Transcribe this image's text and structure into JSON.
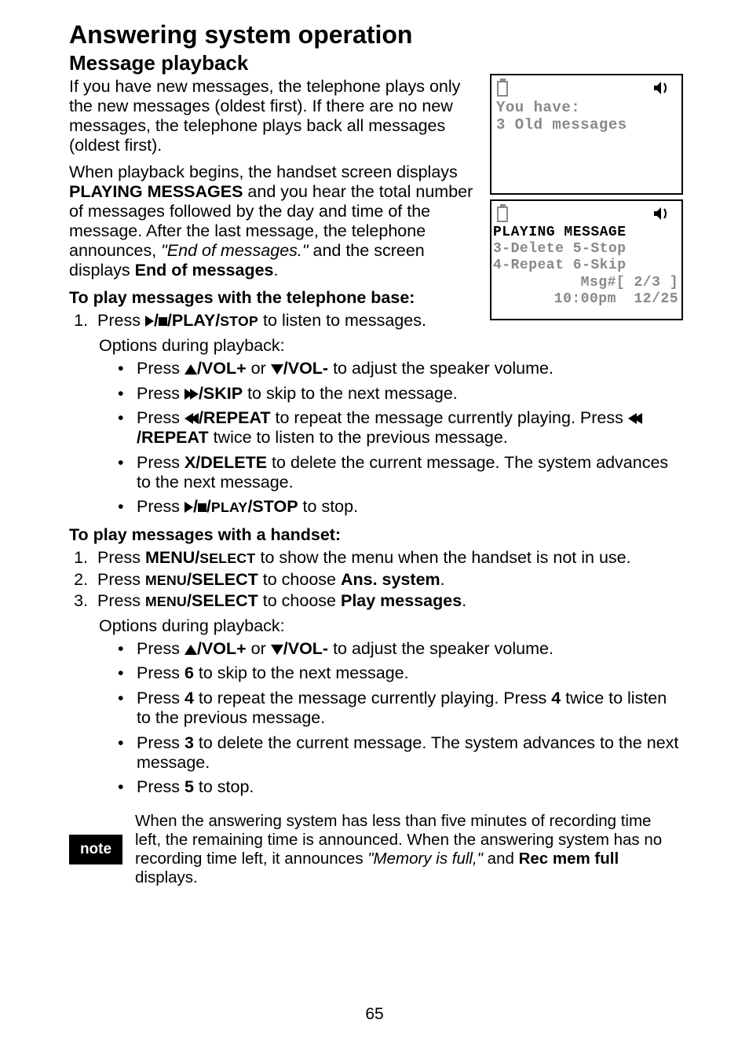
{
  "title": "Answering system operation",
  "section": "Message playback",
  "para1": "If you have new messages, the telephone plays only the new messages (oldest first). If there are no new messages, the telephone plays back all messages (oldest first).",
  "para2_a": "When playback begins, the handset screen displays ",
  "para2_b": "PLAYING MESSAGES",
  "para2_c": " and you hear the total number of messages followed by the day and time of the message. After the last message, the telephone announces, ",
  "para2_d": "\"End of messages.\"",
  "para2_e": " and the screen displays ",
  "para2_f": "End of messages",
  "para2_g": ".",
  "sub_base": "To play messages with the telephone base:",
  "base_step_a": "Press ",
  "base_step_b": "/PLAY/",
  "base_step_c": "STOP",
  "base_step_d": " to listen to messages.",
  "opts_label": "Options during playback:",
  "b_vol_a": "Press  ",
  "b_vol_b": "/VOL+",
  "b_vol_c": " or ",
  "b_vol_d": "/VOL-",
  "b_vol_e": " to adjust the speaker volume.",
  "b_skip_a": "Press ",
  "b_skip_b": "/SKIP",
  "b_skip_c": " to skip to the next message.",
  "b_rep_a": "Press ",
  "b_rep_b": "/REPEAT",
  "b_rep_c": " to repeat the message currently playing. Press ",
  "b_rep_d": "/REPEAT",
  "b_rep_e": " twice to listen to the previous message.",
  "b_del_a": "Press ",
  "b_del_b": "X/DELETE",
  "b_del_c": " to delete the current message. The system advances to the next message.",
  "b_stop_a": "Press ",
  "b_stop_b": "/",
  "b_stop_c": "PLAY",
  "b_stop_d": "/STOP",
  "b_stop_e": " to stop.",
  "sub_hs": "To play messages with a handset:",
  "hs1_a": "Press ",
  "hs1_b": "MENU/",
  "hs1_c": "SELECT",
  "hs1_d": " to show the menu when the handset is not in use.",
  "hs2_a": "Press ",
  "hs2_b": "MENU",
  "hs2_c": "/SELECT",
  "hs2_d": " to choose ",
  "hs2_e": "Ans. system",
  "hs2_f": ".",
  "hs3_a": "Press ",
  "hs3_b": "MENU",
  "hs3_c": "/SELECT",
  "hs3_d": " to choose ",
  "hs3_e": "Play messages",
  "hs3_f": ".",
  "h_vol_a": "Press ",
  "h_vol_b": "/VOL+",
  "h_vol_c": " or ",
  "h_vol_d": "/VOL-",
  "h_vol_e": " to adjust the speaker volume.",
  "h_skip_a": "Press ",
  "h_skip_b": "6",
  "h_skip_c": " to skip to the next message.",
  "h_rep_a": "Press ",
  "h_rep_b": "4",
  "h_rep_c": " to repeat the message currently playing. Press ",
  "h_rep_d": "4",
  "h_rep_e": " twice to listen to the previous message.",
  "h_del_a": "Press ",
  "h_del_b": "3",
  "h_del_c": " to delete the current message. The system advances to the next message.",
  "h_stop_a": "Press ",
  "h_stop_b": "5",
  "h_stop_c": " to stop.",
  "note_label": "note",
  "note_a": "When the answering system has less than five minutes of recording time left, the remaining time is announced. When the answering system has no recording time left, it announces ",
  "note_b": "\"Memory is full,\"",
  "note_c": " and ",
  "note_d": "Rec mem full",
  "note_e": " displays.",
  "lcd1_l1": "You have:",
  "lcd1_l2": "3 Old messages",
  "lcd2_l1": "PLAYING MESSAGE",
  "lcd2_l2": "3-Delete 5-Stop",
  "lcd2_l3": "4-Repeat 6-Skip",
  "lcd2_l4": "Msg#[ 2/3 ]",
  "lcd2_l5": "10:00pm  12/25",
  "pageno": "65"
}
